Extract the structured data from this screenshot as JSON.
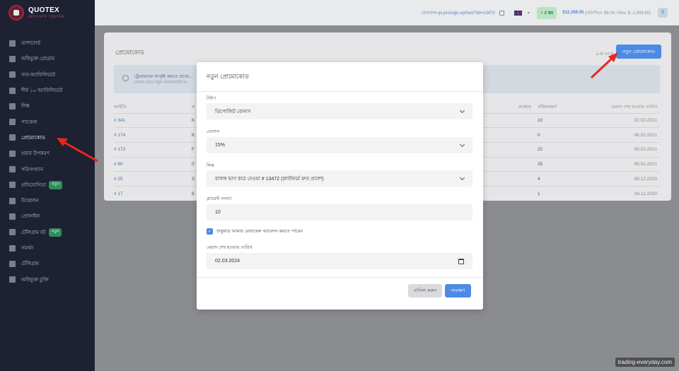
{
  "brand": {
    "name": "QUOTEX",
    "subtitle": "AFFILIATE CENTER"
  },
  "sidebar": {
    "items": [
      {
        "label": "ড্যাশবোর্ড",
        "icon": "dashboard-icon"
      },
      {
        "label": "অধিভুক্ত প্রোগ্রাম",
        "icon": "folder-icon"
      },
      {
        "label": "সাব-অ্যাফিলিয়েট",
        "icon": "send-icon"
      },
      {
        "label": "শীর্ষ ১০ অ্যাফিলিয়েট",
        "icon": "trending-icon"
      },
      {
        "label": "লিঙ্ক",
        "icon": "link-icon"
      },
      {
        "label": "প্যাকেজ",
        "icon": "box-icon"
      },
      {
        "label": "প্রোমোকোড",
        "icon": "toggle-icon",
        "active": true
      },
      {
        "label": "প্রচার উপকরণ",
        "icon": "materials-icon"
      },
      {
        "label": "পরিসংখ্যান",
        "icon": "pie-chart-icon"
      },
      {
        "label": "প্রতিযোগিতা",
        "icon": "trophy-icon",
        "badge": "নতুন"
      },
      {
        "label": "উত্তোলন",
        "icon": "wallet-icon"
      },
      {
        "label": "প্রোফাইল",
        "icon": "user-icon"
      },
      {
        "label": "টেলিগ্রাম বট",
        "icon": "bot-icon",
        "badge": "নতুন"
      },
      {
        "label": "সমর্থন",
        "icon": "headset-icon"
      },
      {
        "label": "টেলিগ্রাম",
        "icon": "telegram-icon"
      },
      {
        "label": "অধিভুক্ত চুক্তি",
        "icon": "document-icon"
      }
    ]
  },
  "topbar": {
    "referral_link": "রেফারাল-qx.pro/sign-up/fast/?lid=13472",
    "pill": "⚡ 2 স্তর",
    "balance": "$12,388.05",
    "balance_sub": "(অনিশ্চিত: $9.04 / Rev. $ -1,008.65)",
    "avatar": "S"
  },
  "page": {
    "title": "প্রোমোকোড",
    "count": "1–6 এর 6",
    "new_button": "নতুন প্রোমোকোড",
    "info_line1": "ট্রেডারদের আকৃষ্ট করতে প্রচার...",
    "info_line2": "প্রোমো কোড নতুন ব্যবহারকারীদের..."
  },
  "table": {
    "headers": [
      "আইডি",
      "প্র",
      "ব্যবহার",
      "সক্রিয়করণ",
      "মেয়াদ শেষ হওয়ার তারিখ"
    ],
    "rows": [
      {
        "id": "# 341",
        "code": "K",
        "activations": "10",
        "expires": "02.02.2021"
      },
      {
        "id": "# 174",
        "code": "K",
        "activations": "0",
        "expires": "06.02.2021"
      },
      {
        "id": "# 173",
        "code": "F",
        "activations": "22",
        "expires": "06.02.2021"
      },
      {
        "id": "# 60",
        "code": "0",
        "activations": "25",
        "expires": "06.01.2021"
      },
      {
        "id": "# 25",
        "code": "S",
        "activations": "4",
        "expires": "09.12.2020"
      },
      {
        "id": "# 17",
        "code": "6",
        "activations": "1",
        "expires": "08.11.2020"
      }
    ]
  },
  "modal": {
    "title": "নতুন প্রোমোকোড",
    "type_label": "টাইপ",
    "type_value": "ডিপোজিট বোনাস",
    "bonus_label": "বোনাস",
    "bonus_value": "15%",
    "link_label": "লিঙ্ক",
    "link_value": "রাজস্ব ভাগ করে নেওয়া # 13472 (প্ল্যাটফর্মে দ্রুত প্রবেশ)",
    "clients_label": "ক্লায়েন্ট সংখ্যা",
    "clients_value": "10",
    "checkbox_label": "শুধুমাত্র আমার রেফারেল আবেদন করতে পারেন",
    "checkbox_checked": true,
    "expiry_label": "মেয়াদ শেষ হওয়ার তারিখ",
    "expiry_value": "02.03.2024",
    "cancel": "বাতিল করুন",
    "save": "সংরক্ষণ"
  },
  "watermark": "trading-everyday.com"
}
